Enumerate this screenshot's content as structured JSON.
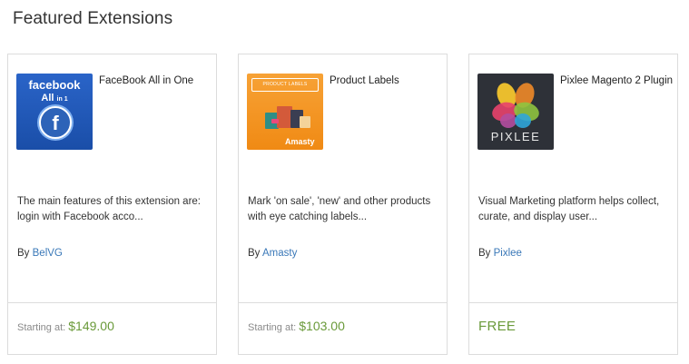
{
  "section": {
    "title": "Featured Extensions"
  },
  "products": [
    {
      "name": "FaceBook All in One",
      "thumb": {
        "line1": "facebook",
        "line2a": "All",
        "line2b": "in 1",
        "glyph": "f"
      },
      "description": "The main features of this extension are: login with Facebook acco...",
      "vendor_prefix": "By",
      "vendor": "BelVG",
      "price_label": "Starting at:",
      "price": "$149.00"
    },
    {
      "name": "Product Labels",
      "thumb": {
        "banner": "PRODUCT LABELS",
        "brand": "Amasty"
      },
      "description": "Mark 'on sale', 'new' and other products with eye catching labels...",
      "vendor_prefix": "By",
      "vendor": "Amasty",
      "price_label": "Starting at:",
      "price": "$103.00"
    },
    {
      "name": "Pixlee Magento 2 Plugin",
      "thumb": {
        "brand": "PIXLEE"
      },
      "description": "Visual Marketing platform helps collect, curate, and display user...",
      "vendor_prefix": "By",
      "vendor": "Pixlee",
      "price_label": "",
      "price": "FREE"
    }
  ],
  "colors": {
    "link": "#3a78b8",
    "price": "#6a9a3a",
    "border": "#dcdcdc"
  }
}
